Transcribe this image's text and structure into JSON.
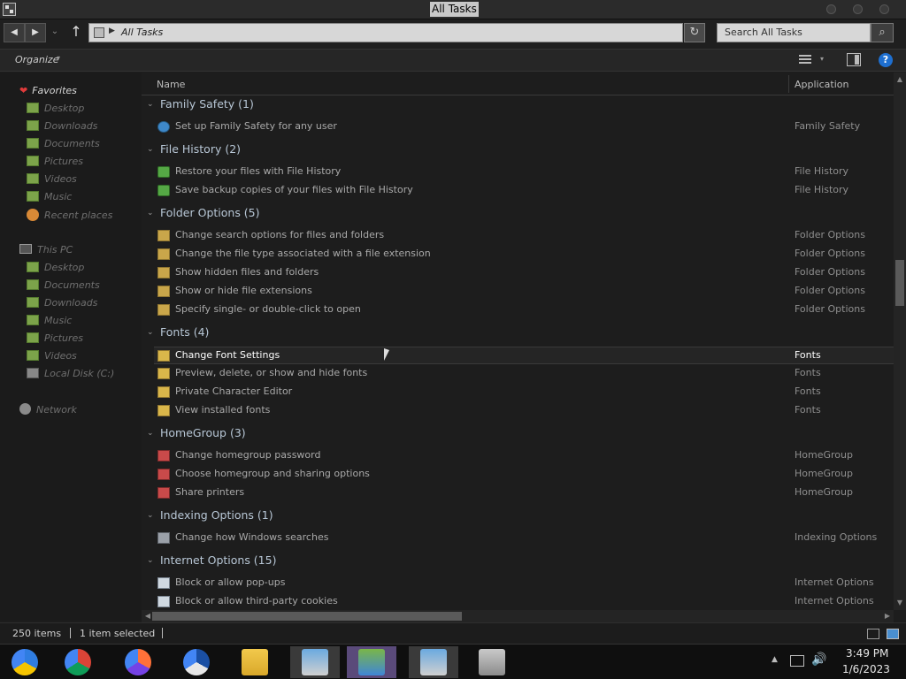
{
  "window": {
    "title": "All Tasks"
  },
  "address": {
    "path": "All Tasks",
    "search_placeholder": "Search All Tasks"
  },
  "toolbar": {
    "organize": "Organize"
  },
  "sidebar": {
    "favorites_label": "Favorites",
    "favorites": [
      "Desktop",
      "Downloads",
      "Documents",
      "Pictures",
      "Videos",
      "Music",
      "Recent places"
    ],
    "pc_label": "This PC",
    "pc_items": [
      "Desktop",
      "Documents",
      "Downloads",
      "Music",
      "Pictures",
      "Videos",
      "Local Disk (C:)"
    ],
    "network_label": "Network"
  },
  "columns": {
    "name": "Name",
    "application": "Application"
  },
  "groups": [
    {
      "title": "Family Safety (1)",
      "tasks": [
        {
          "name": "Set up Family Safety for any user",
          "app": "Family Safety",
          "icon": "family-safety-icon"
        }
      ]
    },
    {
      "title": "File History (2)",
      "tasks": [
        {
          "name": "Restore your files with File History",
          "app": "File History",
          "icon": "file-history-icon"
        },
        {
          "name": "Save backup copies of your files with File History",
          "app": "File History",
          "icon": "file-history-icon"
        }
      ]
    },
    {
      "title": "Folder Options (5)",
      "tasks": [
        {
          "name": "Change search options for files and folders",
          "app": "Folder Options",
          "icon": "folder-icon"
        },
        {
          "name": "Change the file type associated with a file extension",
          "app": "Folder Options",
          "icon": "folder-icon"
        },
        {
          "name": "Show hidden files and folders",
          "app": "Folder Options",
          "icon": "folder-icon"
        },
        {
          "name": "Show or hide file extensions",
          "app": "Folder Options",
          "icon": "folder-icon"
        },
        {
          "name": "Specify single- or double-click to open",
          "app": "Folder Options",
          "icon": "folder-icon"
        }
      ]
    },
    {
      "title": "Fonts (4)",
      "tasks": [
        {
          "name": "Change Font Settings",
          "app": "Fonts",
          "icon": "fonts-icon",
          "selected": true
        },
        {
          "name": "Preview, delete, or show and hide fonts",
          "app": "Fonts",
          "icon": "fonts-icon"
        },
        {
          "name": "Private Character Editor",
          "app": "Fonts",
          "icon": "fonts-icon"
        },
        {
          "name": "View installed fonts",
          "app": "Fonts",
          "icon": "fonts-icon"
        }
      ]
    },
    {
      "title": "HomeGroup (3)",
      "tasks": [
        {
          "name": "Change homegroup password",
          "app": "HomeGroup",
          "icon": "homegroup-icon"
        },
        {
          "name": "Choose homegroup and sharing options",
          "app": "HomeGroup",
          "icon": "homegroup-icon"
        },
        {
          "name": "Share printers",
          "app": "HomeGroup",
          "icon": "homegroup-icon"
        }
      ]
    },
    {
      "title": "Indexing Options (1)",
      "tasks": [
        {
          "name": "Change how Windows searches",
          "app": "Indexing Options",
          "icon": "indexing-icon"
        }
      ]
    },
    {
      "title": "Internet Options (15)",
      "tasks": [
        {
          "name": "Block or allow pop-ups",
          "app": "Internet Options",
          "icon": "internet-options-icon"
        },
        {
          "name": "Block or allow third-party cookies",
          "app": "Internet Options",
          "icon": "internet-options-icon"
        }
      ]
    }
  ],
  "status": {
    "items": "250 items",
    "selected": "1 item selected"
  },
  "taskbar": {
    "apps": [
      "chrome-dev-icon",
      "chrome-icon",
      "firefox-icon",
      "obama-logo-icon",
      "file-explorer-icon",
      "control-panel-icon",
      "people-icon",
      "control-panel-icon",
      "archive-icon"
    ],
    "time": "3:49 PM",
    "date": "1/6/2023"
  },
  "colors": {
    "background": "#1d1d1d",
    "selected_row": "#252525",
    "accent": "#1e6fd0"
  }
}
